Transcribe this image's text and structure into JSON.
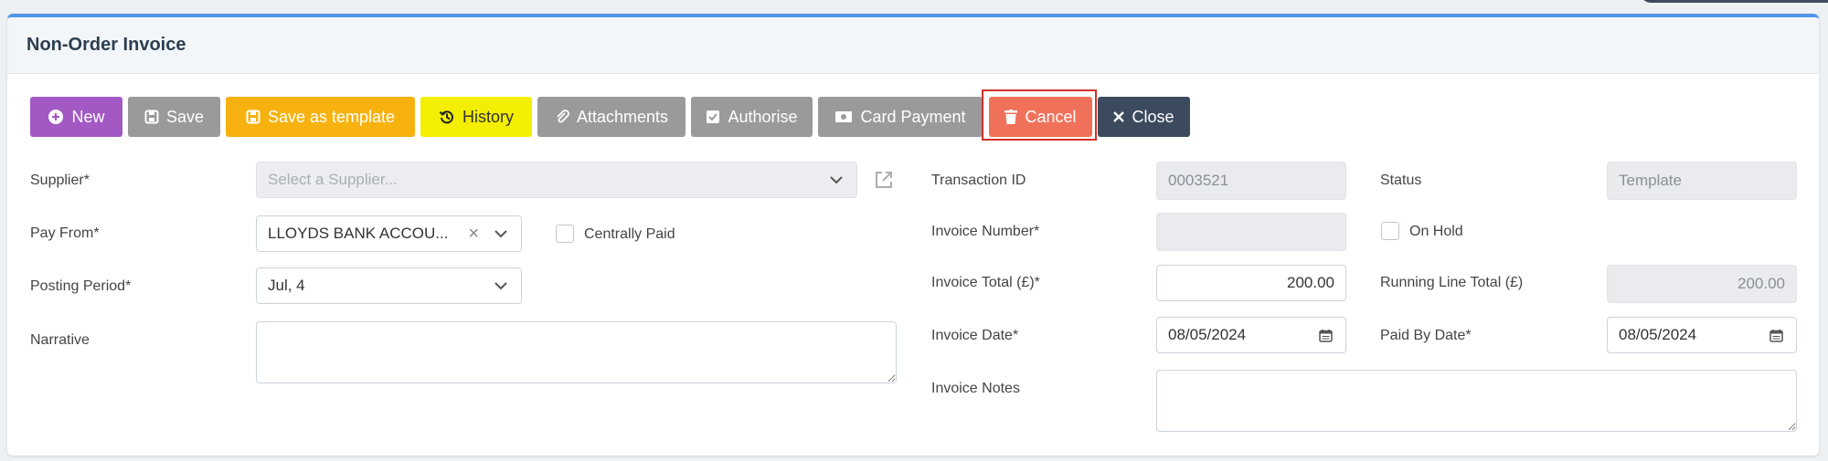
{
  "page": {
    "title": "Non-Order Invoice"
  },
  "toolbar": {
    "new_label": "New",
    "save_label": "Save",
    "save_template_label": "Save as template",
    "history_label": "History",
    "attachments_label": "Attachments",
    "authorise_label": "Authorise",
    "card_payment_label": "Card Payment",
    "cancel_label": "Cancel",
    "close_label": "Close"
  },
  "form": {
    "supplier": {
      "label": "Supplier*",
      "placeholder": "Select a Supplier..."
    },
    "pay_from": {
      "label": "Pay From*",
      "value": "LLOYDS BANK ACCOU..."
    },
    "centrally_paid": {
      "label": "Centrally Paid",
      "checked": false
    },
    "posting_period": {
      "label": "Posting Period*",
      "value": "Jul, 4"
    },
    "narrative": {
      "label": "Narrative",
      "value": ""
    },
    "transaction_id": {
      "label": "Transaction ID",
      "value": "0003521"
    },
    "invoice_number": {
      "label": "Invoice Number*",
      "value": ""
    },
    "invoice_total": {
      "label": "Invoice Total (£)*",
      "value": "200.00"
    },
    "invoice_date": {
      "label": "Invoice Date*",
      "value": "08/05/2024"
    },
    "invoice_notes": {
      "label": "Invoice Notes",
      "value": ""
    },
    "status": {
      "label": "Status",
      "value": "Template"
    },
    "on_hold": {
      "label": "On Hold",
      "checked": false
    },
    "running_line_total": {
      "label": "Running Line Total (£)",
      "value": "200.00"
    },
    "paid_by_date": {
      "label": "Paid By Date*",
      "value": "08/05/2024"
    }
  },
  "colors": {
    "accent": "#4f97e6",
    "new": "#a259c4",
    "neutral": "#9a9a9a",
    "template": "#f7b20f",
    "history": "#f4ef00",
    "cancel": "#f0715a",
    "close": "#3c4a5e",
    "highlight": "#d6302b"
  },
  "icons": {
    "new": "plus-circle-icon",
    "save": "floppy-icon",
    "save_template": "floppy-icon",
    "history": "history-icon",
    "attachments": "paperclip-icon",
    "authorise": "check-square-icon",
    "card_payment": "money-icon",
    "cancel": "trash-icon",
    "close": "close-icon",
    "dropdown": "chevron-down-icon",
    "external": "external-link-icon",
    "calendar": "calendar-icon"
  }
}
